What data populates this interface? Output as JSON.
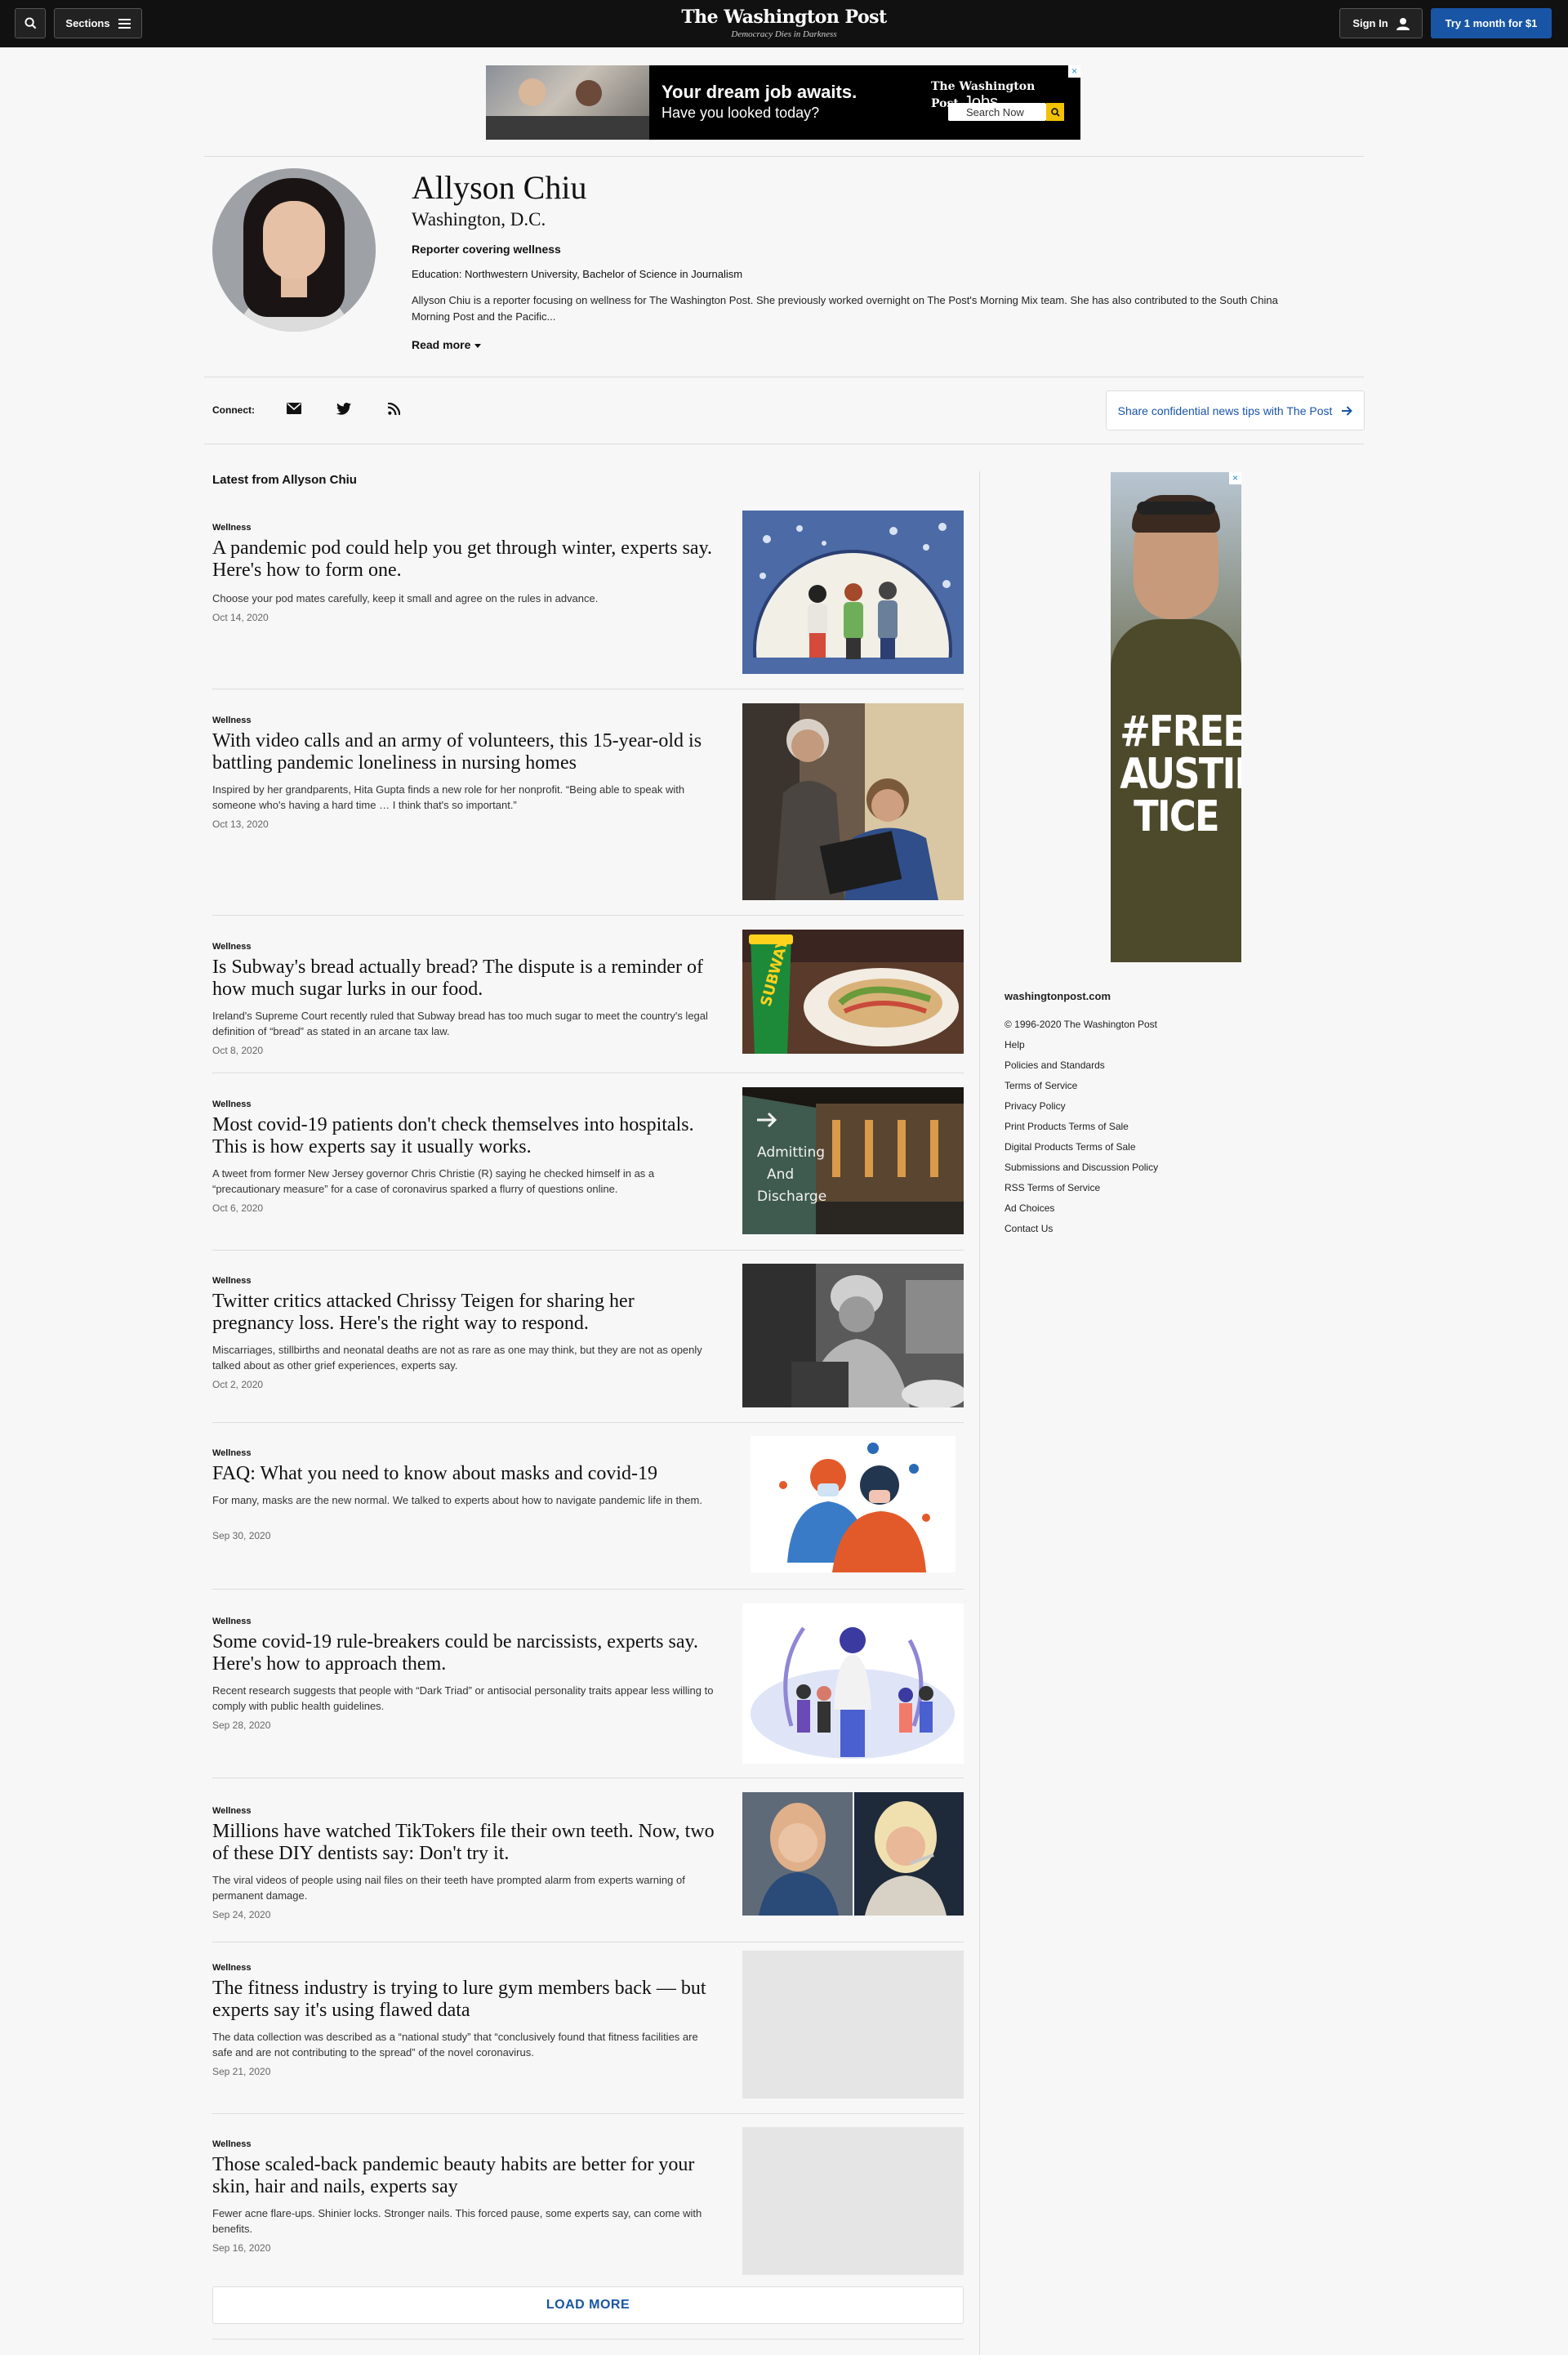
{
  "header": {
    "sections_label": "Sections",
    "logo": "The Washington Post",
    "tagline": "Democracy Dies in Darkness",
    "signin_label": "Sign In",
    "trial_label": "Try 1 month for $1"
  },
  "ad_banner": {
    "headline": "Your dream job awaits.",
    "subline": "Have you looked today?",
    "brand": "The Washington Post",
    "brand_suffix": "Jobs",
    "search_label": "Search Now",
    "close": "×"
  },
  "profile": {
    "name": "Allyson Chiu",
    "location": "Washington, D.C.",
    "role": "Reporter covering wellness",
    "education": "Education: Northwestern University, Bachelor of Science in Journalism",
    "bio": "Allyson Chiu is a reporter focusing on wellness for The Washington Post. She previously worked overnight on The Post's Morning Mix team. She has also contributed to the South China Morning Post and the Pacific...",
    "read_more": "Read more"
  },
  "connect": {
    "label": "Connect:",
    "tips_label": "Share confidential news tips with The Post"
  },
  "feed": {
    "title": "Latest from Allyson Chiu",
    "load_more": "LOAD MORE",
    "items": [
      {
        "kicker": "Wellness",
        "headline": "A pandemic pod could help you get through winter, experts say. Here's how to form one.",
        "blurb": "Choose your pod mates carefully, keep it small and agree on the rules in advance.",
        "date": "Oct 14, 2020"
      },
      {
        "kicker": "Wellness",
        "headline": "With video calls and an army of volunteers, this 15-year-old is battling pandemic loneliness in nursing homes",
        "blurb": "Inspired by her grandparents, Hita Gupta finds a new role for her nonprofit. “Being able to speak with someone who's having a hard time … I think that's so important.”",
        "date": "Oct 13, 2020"
      },
      {
        "kicker": "Wellness",
        "headline": "Is Subway's bread actually bread? The dispute is a reminder of how much sugar lurks in our food.",
        "blurb": "Ireland's Supreme Court recently ruled that Subway bread has too much sugar to meet the country's legal definition of “bread” as stated in an arcane tax law.",
        "date": "Oct 8, 2020"
      },
      {
        "kicker": "Wellness",
        "headline": "Most covid-19 patients don't check themselves into hospitals. This is how experts say it usually works.",
        "blurb": "A tweet from former New Jersey governor Chris Christie (R) saying he checked himself in as a “precautionary measure” for a case of coronavirus sparked a flurry of questions online.",
        "date": "Oct 6, 2020"
      },
      {
        "kicker": "Wellness",
        "headline": "Twitter critics attacked Chrissy Teigen for sharing her pregnancy loss. Here's the right way to respond.",
        "blurb": "Miscarriages, stillbirths and neonatal deaths are not as rare as one may think, but they are not as openly talked about as other grief experiences, experts say.",
        "date": "Oct 2, 2020"
      },
      {
        "kicker": "Wellness",
        "headline": "FAQ: What you need to know about masks and covid-19",
        "blurb": "For many, masks are the new normal. We talked to experts about how to navigate pandemic life in them.",
        "date": "Sep 30, 2020"
      },
      {
        "kicker": "Wellness",
        "headline": "Some covid-19 rule-breakers could be narcissists, experts say. Here's how to approach them.",
        "blurb": "Recent research suggests that people with “Dark Triad” or antisocial personality traits appear less willing to comply with public health guidelines.",
        "date": "Sep 28, 2020"
      },
      {
        "kicker": "Wellness",
        "headline": "Millions have watched TikTokers file their own teeth. Now, two of these DIY dentists say: Don't try it.",
        "blurb": "The viral videos of people using nail files on their teeth have prompted alarm from experts warning of permanent damage.",
        "date": "Sep 24, 2020"
      },
      {
        "kicker": "Wellness",
        "headline": "The fitness industry is trying to lure gym members back — but experts say it's using flawed data",
        "blurb": "The data collection was described as a “national study” that “conclusively found that fitness facilities are safe and are not contributing to the spread” of the novel coronavirus.",
        "date": "Sep 21, 2020"
      },
      {
        "kicker": "Wellness",
        "headline": "Those scaled-back pandemic beauty habits are better for your skin, hair and nails, experts say",
        "blurb": "Fewer acne flare-ups. Shinier locks. Stronger nails. This forced pause, some experts say, can come with benefits.",
        "date": "Sep 16, 2020"
      }
    ]
  },
  "rail_ad": {
    "slogan_1": "#FREE",
    "slogan_2": "AUSTIN",
    "slogan_3": "TICE",
    "close": "×"
  },
  "footer": {
    "site": "washingtonpost.com",
    "copyright": "© 1996-2020 The Washington Post",
    "links": [
      "Help",
      "Policies and Standards",
      "Terms of Service",
      "Privacy Policy",
      "Print Products Terms of Sale",
      "Digital Products Terms of Sale",
      "Submissions and Discussion Policy",
      "RSS Terms of Service",
      "Ad Choices",
      "Contact Us"
    ]
  },
  "colors": {
    "accent": "#1955a5",
    "topbar": "#111111",
    "background": "#f7f7f7"
  }
}
